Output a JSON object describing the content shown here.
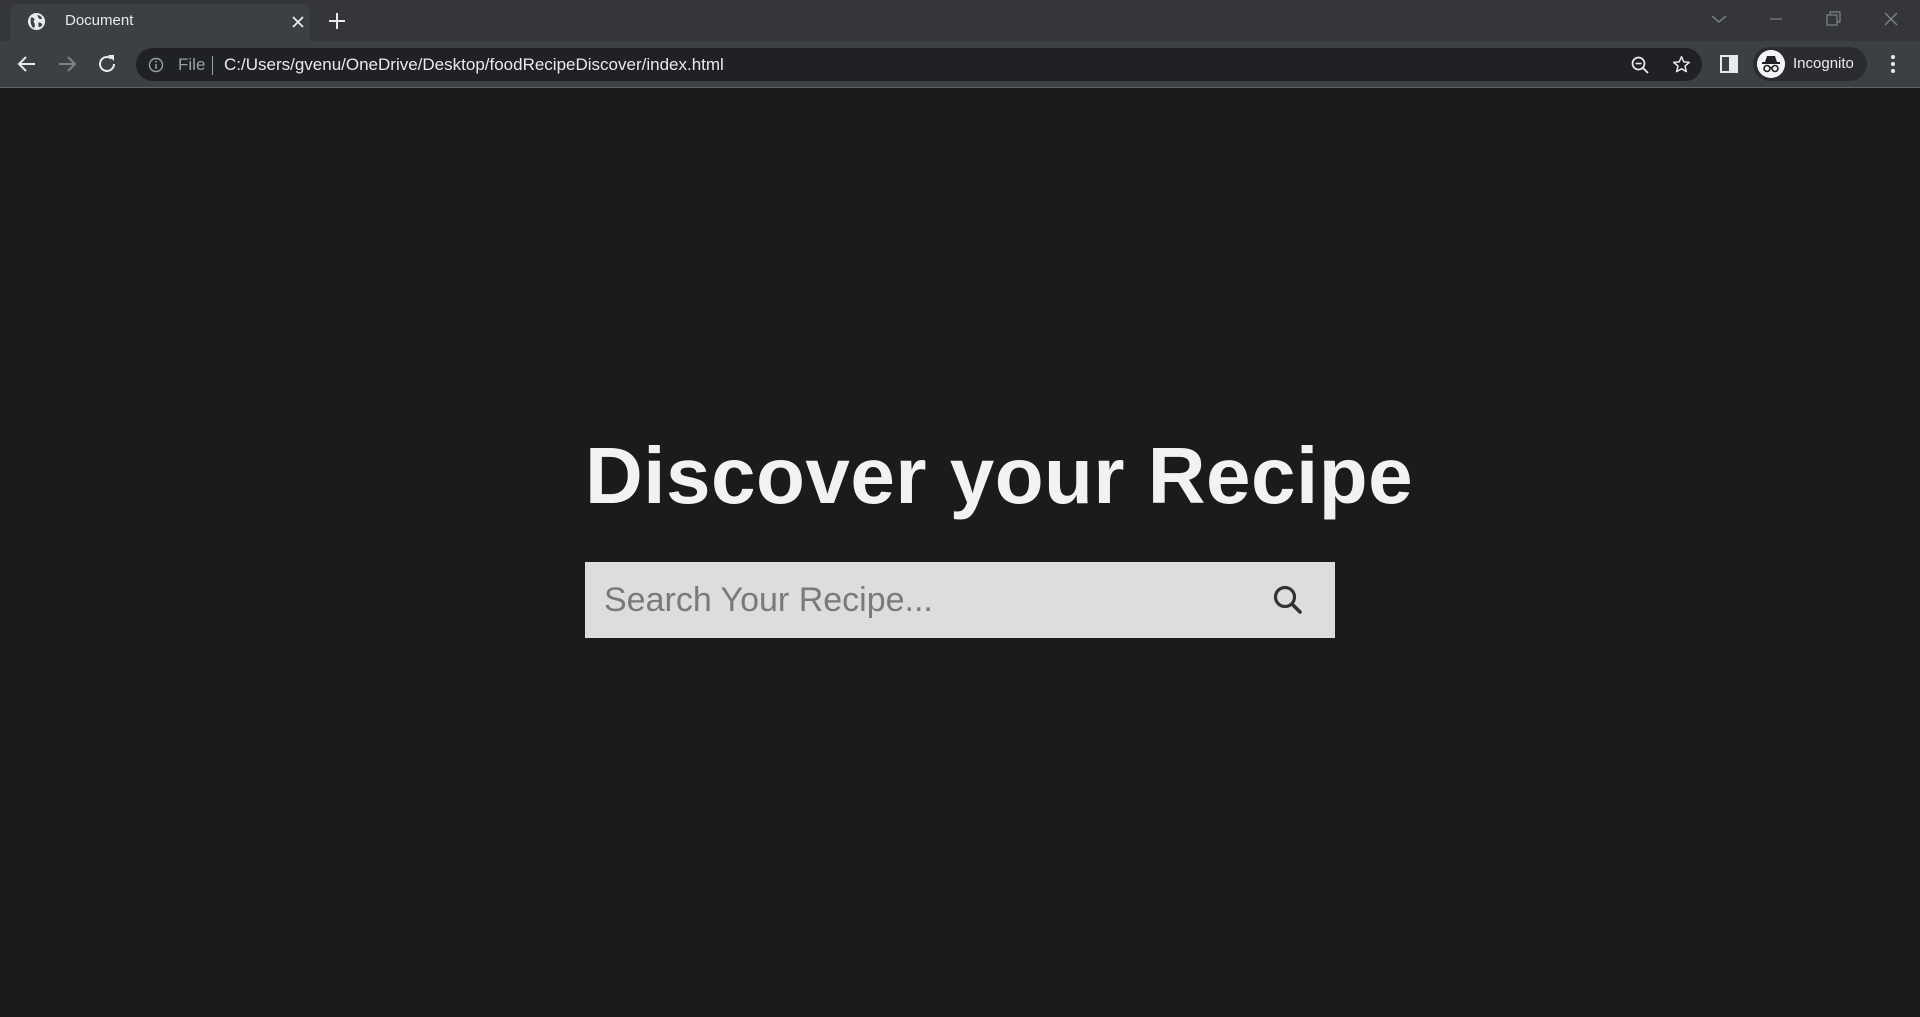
{
  "browser": {
    "tab_title": "Document",
    "scheme_label": "File",
    "url": "C:/Users/gvenu/OneDrive/Desktop/foodRecipeDiscover/index.html",
    "profile_label": "Incognito"
  },
  "page": {
    "headline": "Discover your Recipe",
    "search": {
      "value": "",
      "placeholder": "Search Your Recipe..."
    }
  },
  "colors": {
    "page_background": "#1b1b1b",
    "search_background": "#dddddd",
    "toolbar": "#3c3f44",
    "tabstrip": "#35363a"
  },
  "icons": [
    "globe-icon",
    "close-icon",
    "plus-icon",
    "chevron-down-icon",
    "minimize-icon",
    "restore-icon",
    "back-icon",
    "forward-icon",
    "reload-icon",
    "info-icon",
    "zoom-out-icon",
    "star-icon",
    "side-panel-icon",
    "incognito-icon",
    "kebab-menu-icon",
    "search-icon"
  ]
}
